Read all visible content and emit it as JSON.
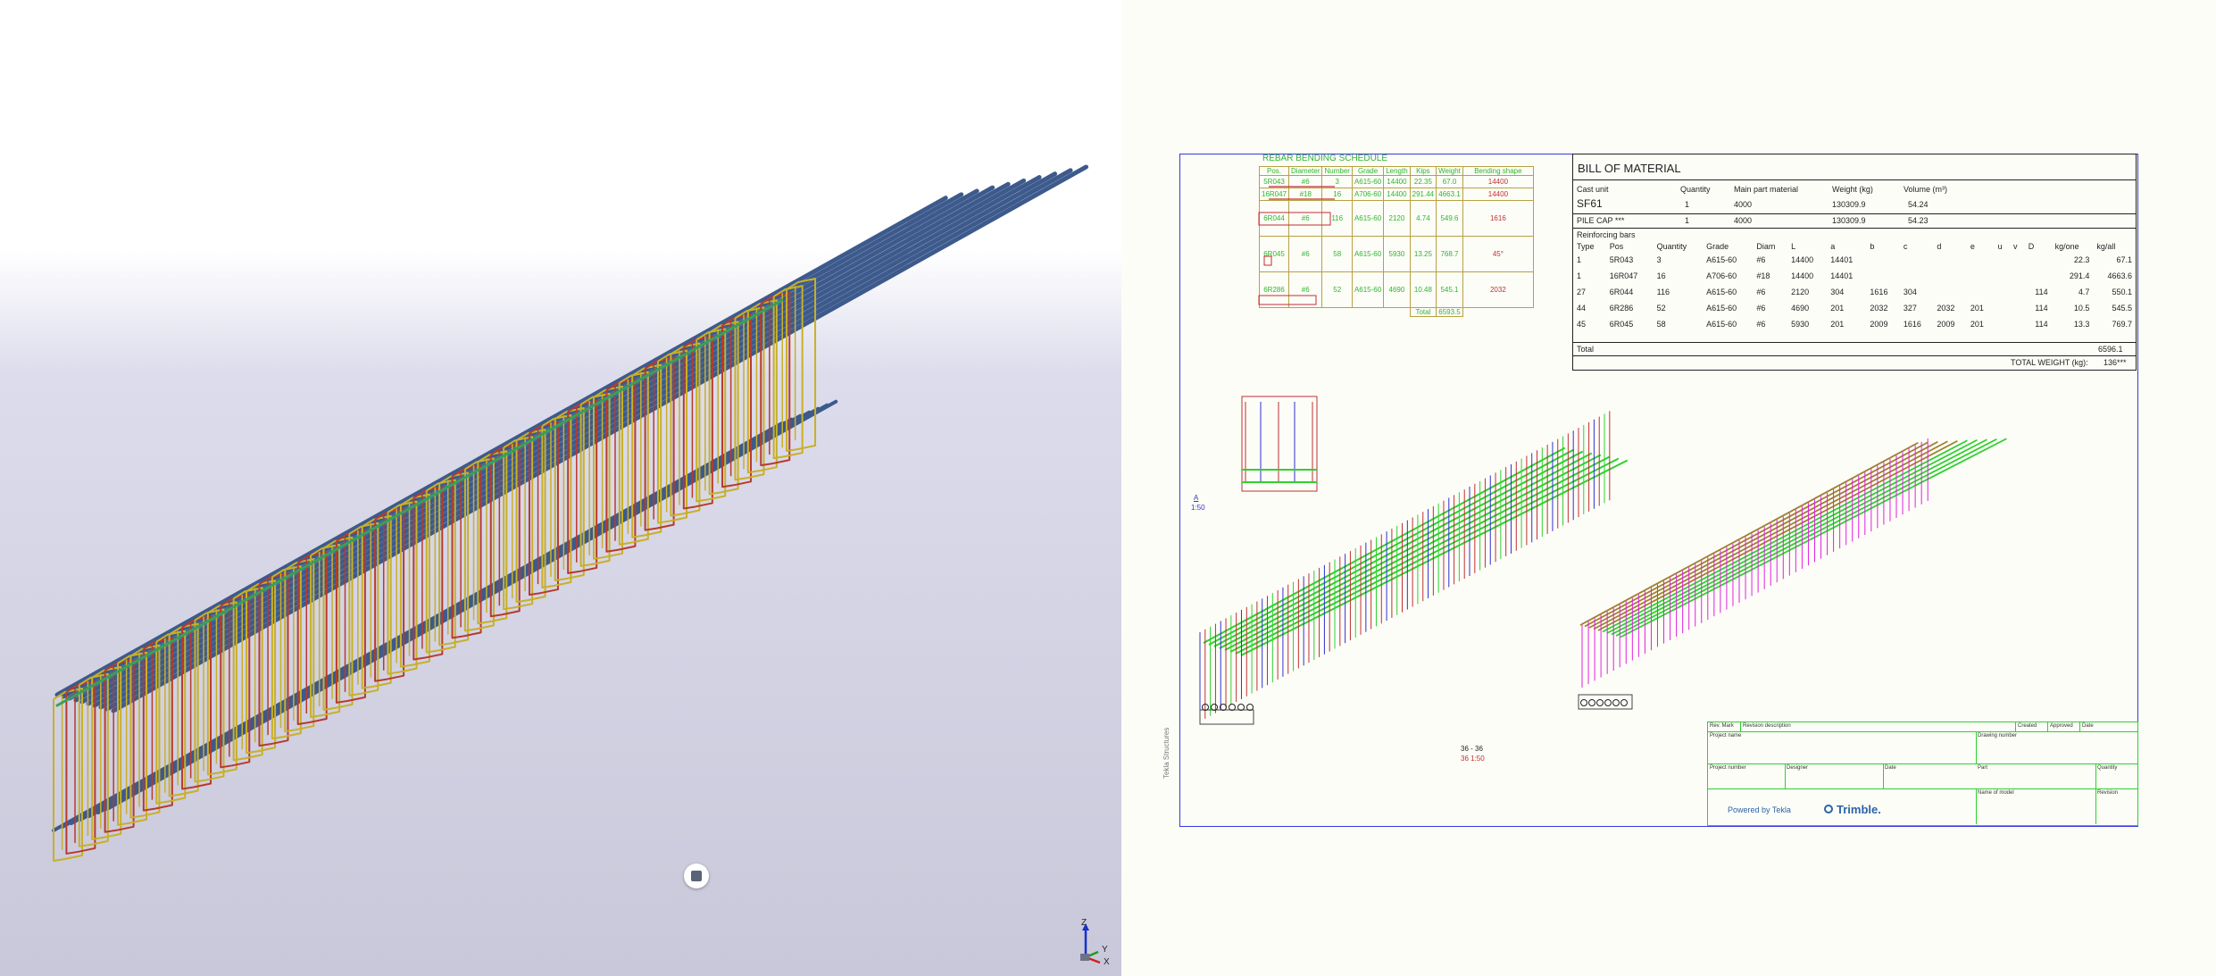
{
  "axes_triad": {
    "z": "Z",
    "y": "Y",
    "x": "X"
  },
  "side_label": "Tekla Structures",
  "rebar_schedule": {
    "title": "REBAR BENDING SCHEDULE",
    "headers": [
      "Pos.",
      "Diameter",
      "Number",
      "Grade",
      "Length",
      "Kips",
      "Weight",
      "Bending shape"
    ],
    "rows": [
      {
        "pos": "5R043",
        "dia": "#6",
        "num": "3",
        "grade": "A615-60",
        "length": "14400",
        "kips": "22.35",
        "weight": "67.0",
        "shape": "14400"
      },
      {
        "pos": "16R047",
        "dia": "#18",
        "num": "16",
        "grade": "A706-60",
        "length": "14400",
        "kips": "291.44",
        "weight": "4663.1",
        "shape": "14400"
      },
      {
        "pos": "6R044",
        "dia": "#6",
        "num": "116",
        "grade": "A615-60",
        "length": "2120",
        "kips": "4.74",
        "weight": "549.6",
        "shape": "1616"
      },
      {
        "pos": "6R045",
        "dia": "#6",
        "num": "58",
        "grade": "A615-60",
        "length": "5930",
        "kips": "13.25",
        "weight": "768.7",
        "shape": "45°"
      },
      {
        "pos": "6R286",
        "dia": "#6",
        "num": "52",
        "grade": "A615-60",
        "length": "4690",
        "kips": "10.48",
        "weight": "545.1",
        "shape": "2032"
      }
    ],
    "total_label": "Total",
    "total_value": "6593.5"
  },
  "bom": {
    "title": "BILL OF MATERIAL",
    "header": [
      "Cast unit",
      "Quantity",
      "Main part material",
      "Weight (kg)",
      "Volume (m³)"
    ],
    "cast_unit": {
      "name": "SF61",
      "qty": "1",
      "material": "4000",
      "weight": "130309.9",
      "volume": "54.24"
    },
    "pile_cap": {
      "name": "PILE CAP ***",
      "qty": "1",
      "material": "4000",
      "weight": "130309.9",
      "volume": "54.23"
    },
    "reinforcing_label": "Reinforcing bars",
    "col_headers": [
      "Type",
      "Pos",
      "Quantity",
      "Grade",
      "Diam",
      "L",
      "a",
      "b",
      "c",
      "d",
      "e",
      "u",
      "v",
      "D",
      "kg/one",
      "kg/all"
    ],
    "rows": [
      [
        "1",
        "5R043",
        "3",
        "A615-60",
        "#6",
        "14400",
        "14401",
        "",
        "",
        "",
        "",
        "",
        "",
        "",
        "22.3",
        "67.1"
      ],
      [
        "1",
        "16R047",
        "16",
        "A706-60",
        "#18",
        "14400",
        "14401",
        "",
        "",
        "",
        "",
        "",
        "",
        "",
        "291.4",
        "4663.6"
      ],
      [
        "27",
        "6R044",
        "116",
        "A615-60",
        "#6",
        "2120",
        "304",
        "1616",
        "304",
        "",
        "",
        "",
        "",
        "114",
        "4.7",
        "550.1"
      ],
      [
        "44",
        "6R286",
        "52",
        "A615-60",
        "#6",
        "4690",
        "201",
        "2032",
        "327",
        "2032",
        "201",
        "",
        "",
        "114",
        "10.5",
        "545.5"
      ],
      [
        "45",
        "6R045",
        "58",
        "A615-60",
        "#6",
        "5930",
        "201",
        "2009",
        "1616",
        "2009",
        "201",
        "",
        "",
        "114",
        "13.3",
        "769.7"
      ]
    ],
    "total_label": "Total",
    "total_value": "6596.1",
    "total_weight_label": "TOTAL WEIGHT (kg):",
    "total_weight_value": "136***"
  },
  "section": {
    "label": "A",
    "scale": "1:50"
  },
  "elevation": {
    "label": "36 - 36",
    "scale": "36 1:50"
  },
  "title_block": {
    "rev_headers": [
      "Rev. Mark",
      "Revision description",
      "Created",
      "Approved",
      "Date"
    ],
    "project_name": "Project name",
    "drawing_number": "Drawing number",
    "project_number": "Project number",
    "designer": "Designer",
    "date": "Date",
    "part": "Part",
    "quantity": "Quantity",
    "name_of_model": "Name of model",
    "revision": "Revision",
    "powered_by": "Powered by Tekla",
    "brand": "Trimble."
  },
  "colors": {
    "bar_blue": "#3d5a8c",
    "stirrup_yellow": "#c8b028",
    "stirrup_red": "#b83a2e",
    "frame_blue": "#3030d0",
    "draw_green": "#2fd02f",
    "draw_magenta": "#e020e0"
  }
}
